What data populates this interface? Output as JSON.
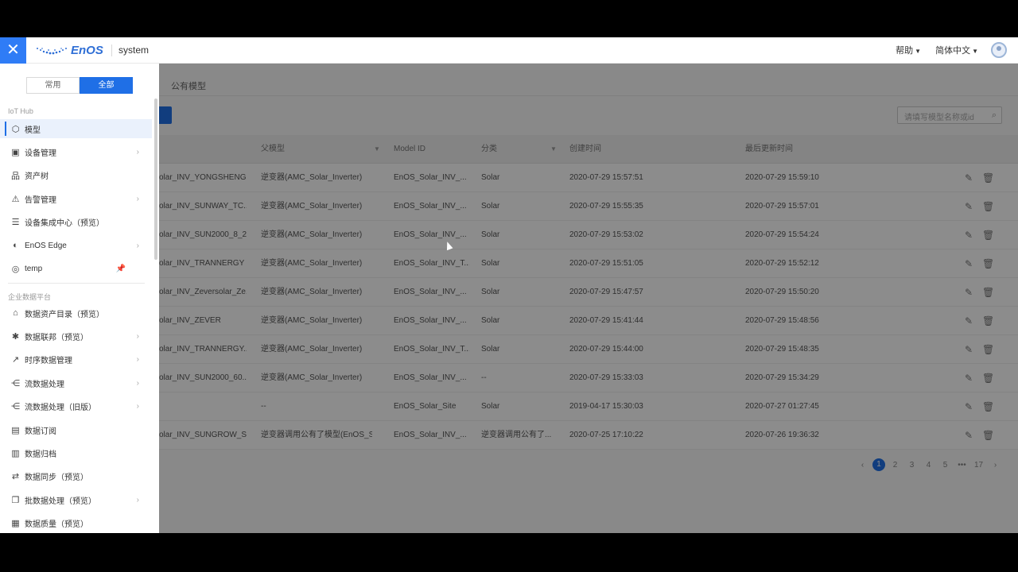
{
  "topbar": {
    "close_icon": "✕",
    "logo_text": "EnOS",
    "system_name": "system",
    "help": "帮助",
    "language": "简体中文"
  },
  "sidebar": {
    "tabs": [
      "常用",
      "全部"
    ],
    "section1_title": "IoT Hub",
    "section1_items": [
      {
        "label": "模型",
        "icon": "cube-icon",
        "chevron": false,
        "active": true
      },
      {
        "label": "设备管理",
        "icon": "device-icon",
        "chevron": true
      },
      {
        "label": "资产树",
        "icon": "tree-icon",
        "chevron": false
      },
      {
        "label": "告警管理",
        "icon": "alarm-icon",
        "chevron": true
      },
      {
        "label": "设备集成中心（预览）",
        "icon": "integration-icon",
        "chevron": false
      },
      {
        "label": "EnOS Edge",
        "icon": "edge-icon",
        "chevron": true
      },
      {
        "label": "temp",
        "icon": "temp-icon",
        "chevron": false,
        "pin": true
      }
    ],
    "section2_title": "企业数据平台",
    "section2_items": [
      {
        "label": "数据资产目录（预览）",
        "icon": "catalog-icon",
        "chevron": false
      },
      {
        "label": "数据联邦（预览）",
        "icon": "federation-icon",
        "chevron": true
      },
      {
        "label": "时序数据管理",
        "icon": "timeseries-icon",
        "chevron": true
      },
      {
        "label": "流数据处理",
        "icon": "stream-icon",
        "chevron": true
      },
      {
        "label": "流数据处理（旧版）",
        "icon": "stream-old-icon",
        "chevron": true
      },
      {
        "label": "数据订阅",
        "icon": "subscribe-icon",
        "chevron": false
      },
      {
        "label": "数据归档",
        "icon": "archive-icon",
        "chevron": false
      },
      {
        "label": "数据同步（预览）",
        "icon": "sync-icon",
        "chevron": false
      },
      {
        "label": "批数据处理（预览）",
        "icon": "batch-icon",
        "chevron": true
      },
      {
        "label": "数据质量（预览）",
        "icon": "quality-icon",
        "chevron": false
      }
    ]
  },
  "main": {
    "breadcrumb": "公有模型",
    "search_placeholder": "请填写模型名称或id",
    "columns": [
      "父模型",
      "Model ID",
      "分类",
      "创建时间",
      "最后更新时间"
    ],
    "rows": [
      [
        "olar_INV_YONGSHENG...",
        "逆变器(AMC_Solar_Inverter)",
        "EnOS_Solar_INV_...",
        "Solar",
        "2020-07-29 15:57:51",
        "2020-07-29 15:59:10"
      ],
      [
        "olar_INV_SUNWAY_TC...",
        "逆变器(AMC_Solar_Inverter)",
        "EnOS_Solar_INV_...",
        "Solar",
        "2020-07-29 15:55:35",
        "2020-07-29 15:57:01"
      ],
      [
        "olar_INV_SUN2000_8_2...",
        "逆变器(AMC_Solar_Inverter)",
        "EnOS_Solar_INV_...",
        "Solar",
        "2020-07-29 15:53:02",
        "2020-07-29 15:54:24"
      ],
      [
        "olar_INV_TRANNERGY",
        "逆变器(AMC_Solar_Inverter)",
        "EnOS_Solar_INV_T...",
        "Solar",
        "2020-07-29 15:51:05",
        "2020-07-29 15:52:12"
      ],
      [
        "olar_INV_Zeversolar_Ze...",
        "逆变器(AMC_Solar_Inverter)",
        "EnOS_Solar_INV_...",
        "Solar",
        "2020-07-29 15:47:57",
        "2020-07-29 15:50:20"
      ],
      [
        "olar_INV_ZEVER",
        "逆变器(AMC_Solar_Inverter)",
        "EnOS_Solar_INV_...",
        "Solar",
        "2020-07-29 15:41:44",
        "2020-07-29 15:48:56"
      ],
      [
        "olar_INV_TRANNERGY...",
        "逆变器(AMC_Solar_Inverter)",
        "EnOS_Solar_INV_T...",
        "Solar",
        "2020-07-29 15:44:00",
        "2020-07-29 15:48:35"
      ],
      [
        "olar_INV_SUN2000_60...",
        "逆变器(AMC_Solar_Inverter)",
        "EnOS_Solar_INV_...",
        "--",
        "2020-07-29 15:33:03",
        "2020-07-29 15:34:29"
      ],
      [
        "",
        "--",
        "EnOS_Solar_Site",
        "Solar",
        "2019-04-17 15:30:03",
        "2020-07-27 01:27:45"
      ],
      [
        "olar_INV_SUNGROW_S...",
        "逆变器调用公有了模型(EnOS_S...",
        "EnOS_Solar_INV_...",
        "逆变器调用公有了...",
        "2020-07-25 17:10:22",
        "2020-07-26 19:36:32"
      ]
    ],
    "pagination": {
      "prev": "‹",
      "pages": [
        "1",
        "2",
        "3",
        "4",
        "5",
        "•••",
        "17"
      ],
      "next": "›",
      "current": "1"
    }
  },
  "colors": {
    "accent": "#1f6fe6",
    "close_button": "#2f7cf6"
  }
}
